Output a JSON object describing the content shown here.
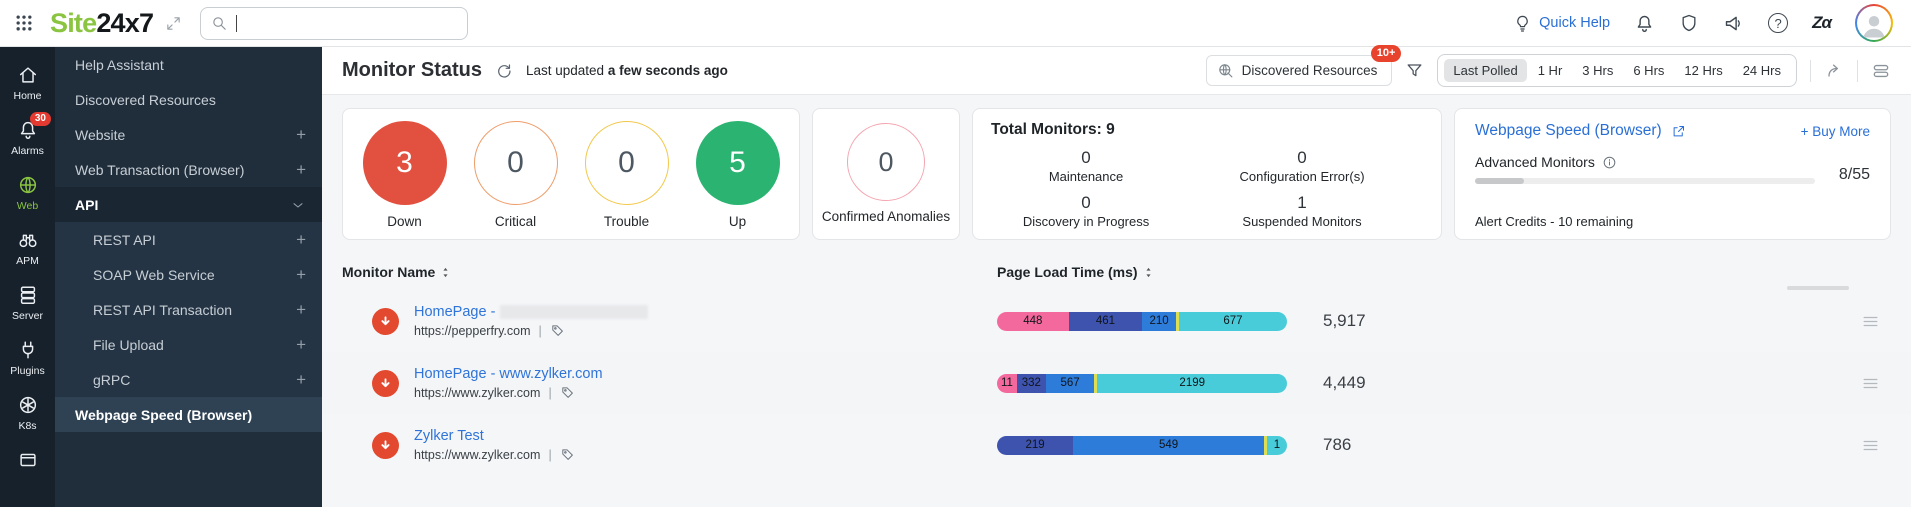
{
  "topbar": {
    "logo_primary": "Site",
    "logo_secondary": "24x7",
    "search": {
      "placeholder": ""
    },
    "quick_help_label": "Quick Help"
  },
  "rail": [
    {
      "label": "Home",
      "icon": "home",
      "badge": null,
      "active": false
    },
    {
      "label": "Alarms",
      "icon": "bell",
      "badge": "30",
      "active": false
    },
    {
      "label": "Web",
      "icon": "globe",
      "badge": null,
      "active": true
    },
    {
      "label": "APM",
      "icon": "binoculars",
      "badge": null,
      "active": false
    },
    {
      "label": "Server",
      "icon": "server",
      "badge": null,
      "active": false
    },
    {
      "label": "Plugins",
      "icon": "plug",
      "badge": null,
      "active": false
    },
    {
      "label": "K8s",
      "icon": "k8s",
      "badge": null,
      "active": false
    },
    {
      "label": "",
      "icon": "window",
      "badge": null,
      "active": false
    }
  ],
  "sidebar": {
    "items": [
      {
        "label": "Help Assistant",
        "type": "plain"
      },
      {
        "label": "Discovered Resources",
        "type": "plain"
      },
      {
        "label": "Website",
        "type": "plus"
      },
      {
        "label": "Web Transaction (Browser)",
        "type": "plus"
      },
      {
        "label": "API",
        "type": "expanded"
      },
      {
        "label": "REST API",
        "type": "plus",
        "indent": true
      },
      {
        "label": "SOAP Web Service",
        "type": "plus",
        "indent": true
      },
      {
        "label": "REST API Transaction",
        "type": "plus",
        "indent": true
      },
      {
        "label": "File Upload",
        "type": "plus",
        "indent": true
      },
      {
        "label": "gRPC",
        "type": "plus",
        "indent": true
      },
      {
        "label": "Webpage Speed (Browser)",
        "type": "selected"
      }
    ]
  },
  "toolbar": {
    "title": "Monitor Status",
    "last_updated_prefix": "Last updated",
    "last_updated_value": "a few seconds ago",
    "discovered_resources_label": "Discovered Resources",
    "discovered_resources_badge": "10+",
    "time_ranges": [
      "Last Polled",
      "1 Hr",
      "3 Hrs",
      "6 Hrs",
      "12 Hrs",
      "24 Hrs"
    ],
    "selected_time_range": "Last Polled"
  },
  "status_overview": {
    "statuses": [
      {
        "label": "Down",
        "count": "3",
        "style": "filled",
        "color": "#e2513f"
      },
      {
        "label": "Critical",
        "count": "0",
        "style": "outline",
        "color": "#ee9d6a"
      },
      {
        "label": "Trouble",
        "count": "0",
        "style": "outline",
        "color": "#f2c84b"
      },
      {
        "label": "Up",
        "count": "5",
        "style": "filled",
        "color": "#2bb471"
      }
    ],
    "anomalies": {
      "label": "Confirmed Anomalies",
      "count": "0",
      "style": "outline",
      "color": "#f3a5b0"
    }
  },
  "summary_card": {
    "title": "Total Monitors: 9",
    "items": [
      {
        "value": "0",
        "label": "Maintenance"
      },
      {
        "value": "0",
        "label": "Configuration Error(s)"
      },
      {
        "value": "0",
        "label": "Discovery in Progress"
      },
      {
        "value": "1",
        "label": "Suspended Monitors"
      }
    ]
  },
  "plan_card": {
    "title": "Webpage Speed (Browser)",
    "buy_more_label": "+ Buy More",
    "advanced_monitors_label": "Advanced Monitors",
    "usage": "8/55",
    "usage_percent": 14.5,
    "alert_credits": "Alert Credits - 10 remaining"
  },
  "table": {
    "columns": [
      {
        "label": "Monitor Name"
      },
      {
        "label": "Page Load Time (ms)"
      }
    ],
    "segment_colors": {
      "pink": "#f3699d",
      "navy": "#3d53ae",
      "blue": "#2d7cd9",
      "yellow": "#dede55",
      "cyan": "#48ccd9"
    },
    "rows": [
      {
        "name": "HomePage -",
        "redacted": true,
        "url": "https://pepperfry.com",
        "total": "5,917",
        "segments": [
          {
            "value": 448,
            "label": "448",
            "color": "pink"
          },
          {
            "value": 461,
            "label": "461",
            "color": "navy"
          },
          {
            "value": 210,
            "label": "210",
            "color": "blue"
          },
          {
            "value": 18,
            "label": "",
            "color": "yellow"
          },
          {
            "value": 677,
            "label": "677",
            "color": "cyan"
          }
        ]
      },
      {
        "name": "HomePage - www.zylker.com",
        "redacted": false,
        "url": "https://www.zylker.com",
        "total": "4,449",
        "segments": [
          {
            "value": 11,
            "label": "11",
            "color": "pink"
          },
          {
            "value": 332,
            "label": "332",
            "color": "navy"
          },
          {
            "value": 567,
            "label": "567",
            "color": "blue"
          },
          {
            "value": 20,
            "label": "",
            "color": "yellow"
          },
          {
            "value": 2199,
            "label": "2199",
            "color": "cyan"
          }
        ]
      },
      {
        "name": "Zylker Test",
        "redacted": false,
        "url": "https://www.zylker.com",
        "total": "786",
        "segments": [
          {
            "value": 219,
            "label": "219",
            "color": "navy"
          },
          {
            "value": 549,
            "label": "549",
            "color": "blue"
          },
          {
            "value": 8,
            "label": "",
            "color": "yellow"
          },
          {
            "value": 12,
            "label": "1",
            "color": "cyan"
          }
        ]
      }
    ]
  }
}
